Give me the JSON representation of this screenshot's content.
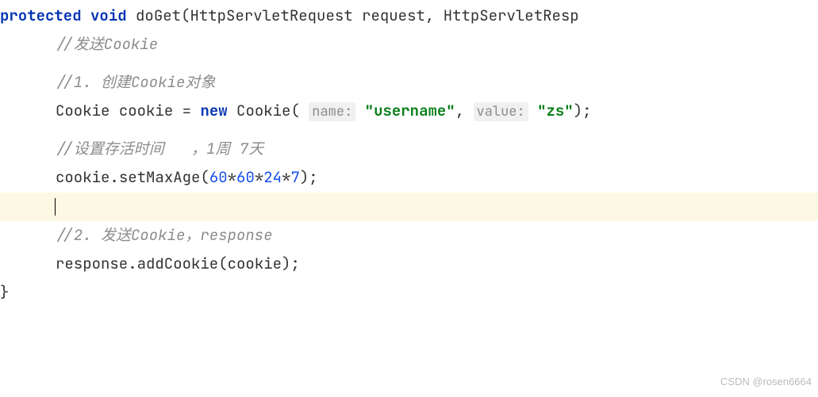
{
  "code": {
    "signature": {
      "protected": "protected",
      "void": "void",
      "method": "doGet",
      "lparen": "(",
      "p1type": "HttpServletRequest",
      "p1name": "request",
      "comma": ",",
      "p2type": "HttpServletResp"
    },
    "comment_send": "//发送Cookie",
    "comment_1": "//1. 创建Cookie对象",
    "line_cookie_decl": {
      "type": "Cookie",
      "var": "cookie",
      "eq": "=",
      "new": "new",
      "ctor": "Cookie",
      "lparen": "(",
      "hint_name": "name:",
      "str_name": "\"username\"",
      "comma": ",",
      "hint_value": "value:",
      "str_value": "\"zs\"",
      "rparen": ")",
      "semi": ";"
    },
    "comment_life": "//设置存活时间   ，1周 7天",
    "line_maxage": {
      "obj": "cookie",
      "dot": ".",
      "method": "setMaxAge",
      "lparen": "(",
      "n1": "60",
      "star1": "*",
      "n2": "60",
      "star2": "*",
      "n3": "24",
      "star3": "*",
      "n4": "7",
      "rparen": ")",
      "semi": ";"
    },
    "comment_2": "//2. 发送Cookie，response",
    "line_add": {
      "obj": "response",
      "dot": ".",
      "method": "addCookie",
      "lparen": "(",
      "arg": "cookie",
      "rparen": ")",
      "semi": ";"
    },
    "closing_brace": "}"
  },
  "watermark": "CSDN @rosen6664"
}
